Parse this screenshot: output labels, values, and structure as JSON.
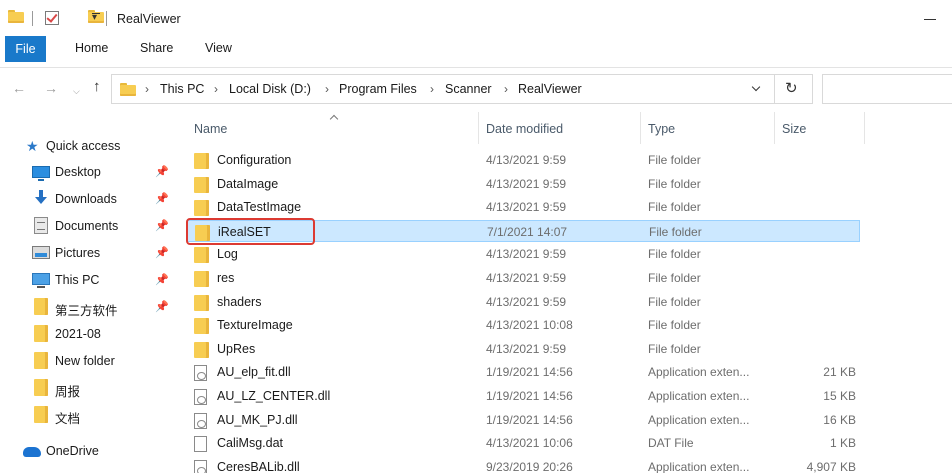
{
  "window": {
    "title": "RealViewer"
  },
  "ribbon": {
    "tabs": [
      "File",
      "Home",
      "Share",
      "View"
    ]
  },
  "address": {
    "crumbs": [
      "This PC",
      "Local Disk (D:)",
      "Program Files",
      "Scanner",
      "RealViewer"
    ]
  },
  "sidebar": {
    "quick_access": "Quick access",
    "items": [
      {
        "label": "Desktop",
        "icon": "desktop-icon",
        "pinned": true
      },
      {
        "label": "Downloads",
        "icon": "downloads-icon",
        "pinned": true
      },
      {
        "label": "Documents",
        "icon": "documents-icon",
        "pinned": true
      },
      {
        "label": "Pictures",
        "icon": "pictures-icon",
        "pinned": true
      },
      {
        "label": "This PC",
        "icon": "computer-icon",
        "pinned": true
      },
      {
        "label": "第三方软件",
        "icon": "folder-icon",
        "pinned": true
      },
      {
        "label": "2021-08",
        "icon": "folder-icon",
        "pinned": false
      },
      {
        "label": "New folder",
        "icon": "folder-icon",
        "pinned": false
      },
      {
        "label": "周报",
        "icon": "folder-icon",
        "pinned": false
      },
      {
        "label": "文档",
        "icon": "folder-icon",
        "pinned": false
      }
    ],
    "onedrive": "OneDrive"
  },
  "columns": {
    "name": "Name",
    "date": "Date modified",
    "type": "Type",
    "size": "Size"
  },
  "files": [
    {
      "name": "Configuration",
      "date": "4/13/2021 9:59",
      "type": "File folder",
      "size": "",
      "icon": "folder-icon"
    },
    {
      "name": "DataImage",
      "date": "4/13/2021 9:59",
      "type": "File folder",
      "size": "",
      "icon": "folder-icon"
    },
    {
      "name": "DataTestImage",
      "date": "4/13/2021 9:59",
      "type": "File folder",
      "size": "",
      "icon": "folder-icon"
    },
    {
      "name": "iRealSET",
      "date": "7/1/2021 14:07",
      "type": "File folder",
      "size": "",
      "icon": "folder-icon",
      "selected": true
    },
    {
      "name": "Log",
      "date": "4/13/2021 9:59",
      "type": "File folder",
      "size": "",
      "icon": "folder-icon"
    },
    {
      "name": "res",
      "date": "4/13/2021 9:59",
      "type": "File folder",
      "size": "",
      "icon": "folder-icon"
    },
    {
      "name": "shaders",
      "date": "4/13/2021 9:59",
      "type": "File folder",
      "size": "",
      "icon": "folder-icon"
    },
    {
      "name": "TextureImage",
      "date": "4/13/2021 10:08",
      "type": "File folder",
      "size": "",
      "icon": "folder-icon"
    },
    {
      "name": "UpRes",
      "date": "4/13/2021 9:59",
      "type": "File folder",
      "size": "",
      "icon": "folder-icon"
    },
    {
      "name": "AU_elp_fit.dll",
      "date": "1/19/2021 14:56",
      "type": "Application exten...",
      "size": "21 KB",
      "icon": "dll-icon"
    },
    {
      "name": "AU_LZ_CENTER.dll",
      "date": "1/19/2021 14:56",
      "type": "Application exten...",
      "size": "15 KB",
      "icon": "dll-icon"
    },
    {
      "name": "AU_MK_PJ.dll",
      "date": "1/19/2021 14:56",
      "type": "Application exten...",
      "size": "16 KB",
      "icon": "dll-icon"
    },
    {
      "name": "CaliMsg.dat",
      "date": "4/13/2021 10:06",
      "type": "DAT File",
      "size": "1 KB",
      "icon": "dat-file-icon"
    },
    {
      "name": "CeresBALib.dll",
      "date": "9/23/2019 20:26",
      "type": "Application exten...",
      "size": "4,907 KB",
      "icon": "dll-icon"
    }
  ],
  "colors": {
    "accent": "#1979ca",
    "selection": "#cce8ff",
    "selection_border": "#99d1ff",
    "highlight": "#dc3a32",
    "folder": "#f7cd52"
  }
}
